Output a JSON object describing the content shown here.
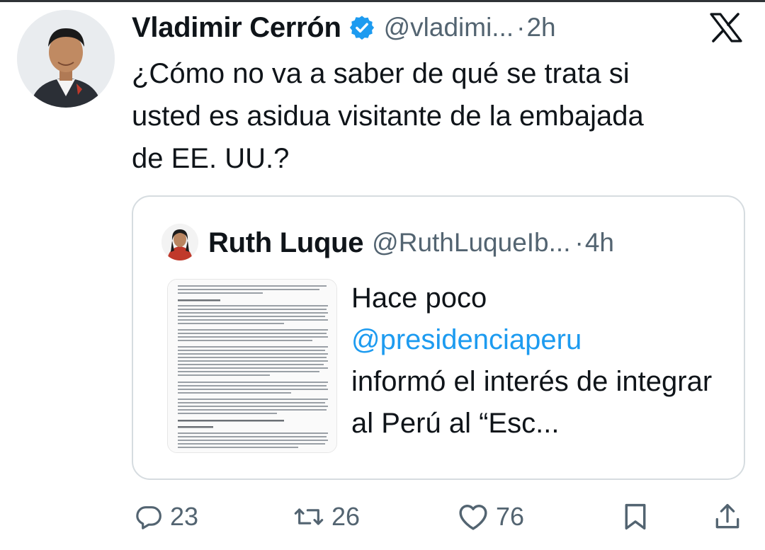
{
  "tweet": {
    "display_name": "Vladimir Cerrón",
    "handle": "@vladimi...",
    "dot": "·",
    "time": "2h",
    "text": "¿Cómo no va a saber de qué se trata si\nusted es asidua visitante de la embajada\nde EE. UU.?"
  },
  "quote": {
    "display_name": "Ruth Luque",
    "handle": "@RuthLuqueIb...",
    "dot": "·",
    "time": "4h",
    "text_before": "Hace poco",
    "mention": "@presidenciaperu",
    "text_after": "informó el interés de integrar al Perú al “Esc..."
  },
  "actions": {
    "replies": "23",
    "reposts": "26",
    "likes": "76"
  },
  "icons": {
    "verified": "verified-badge-icon",
    "logo": "x-logo-icon",
    "reply": "reply-icon",
    "repost": "repost-icon",
    "like": "heart-icon",
    "bookmark": "bookmark-icon",
    "share": "share-icon"
  },
  "colors": {
    "text": "#0f1419",
    "secondary": "#536471",
    "link": "#1d9bf0",
    "verified": "#1d9bf0",
    "border": "#d6dce0"
  }
}
